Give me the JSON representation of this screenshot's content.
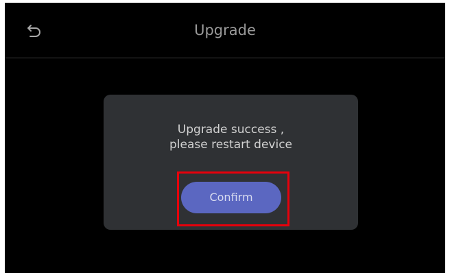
{
  "header": {
    "title": "Upgrade",
    "back_icon": "back-arrow-icon"
  },
  "dialog": {
    "message_line1": "Upgrade success ,",
    "message_line2": "please restart device",
    "confirm_label": "Confirm"
  },
  "colors": {
    "background": "#000000",
    "dialog": "#2f3134",
    "button": "#5b67c1",
    "highlight": "#e8000b"
  }
}
